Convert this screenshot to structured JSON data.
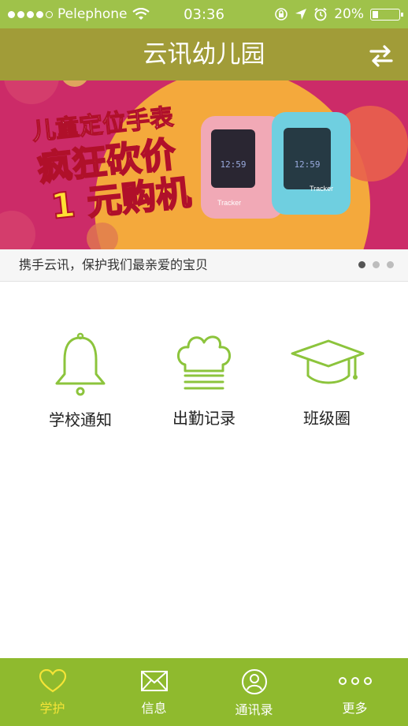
{
  "status": {
    "carrier": "Pelephone",
    "time": "03:36",
    "battery": "20%",
    "battery_level": 0.2
  },
  "nav": {
    "title": "云讯幼儿园",
    "switch_icon": "swap-arrows-icon"
  },
  "banner": {
    "line1": "儿童定位手表",
    "line2": "疯狂砍价",
    "line3": "1 元购机",
    "watch_time": "12:59",
    "watch_brand": "Tracker",
    "caption": "携手云讯，保护我们最亲爱的宝贝",
    "pages": 3,
    "active_page": 1
  },
  "features": [
    {
      "label": "学校通知",
      "icon": "bell-icon"
    },
    {
      "label": "出勤记录",
      "icon": "chef-hat-icon"
    },
    {
      "label": "班级圈",
      "icon": "graduation-cap-icon"
    }
  ],
  "tabs": [
    {
      "label": "学护",
      "icon": "heart-icon",
      "active": true
    },
    {
      "label": "信息",
      "icon": "envelope-icon",
      "active": false
    },
    {
      "label": "通讯录",
      "icon": "contact-icon",
      "active": false
    },
    {
      "label": "更多",
      "icon": "more-dots-icon",
      "active": false
    }
  ],
  "colors": {
    "status_bar": "#9fc24a",
    "nav_bar": "#a19c38",
    "tab_bar": "#8fba2e",
    "active_tab": "#f5e437",
    "icon_green": "#8cc43c",
    "banner_bg": "#cc2b68"
  }
}
